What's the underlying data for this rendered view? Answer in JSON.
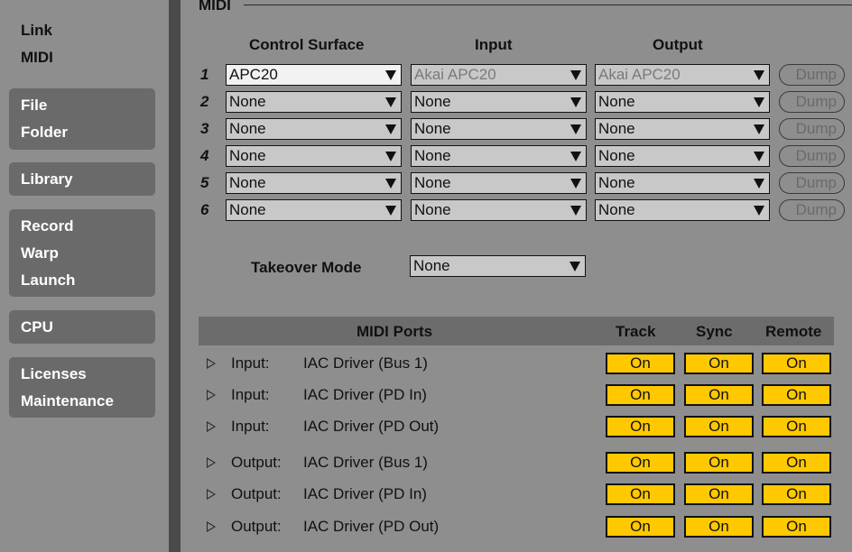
{
  "sidebar": {
    "groups": [
      {
        "items": [
          "Link",
          "MIDI"
        ]
      },
      {
        "items": [
          "File",
          "Folder"
        ]
      },
      {
        "items": [
          "Library"
        ]
      },
      {
        "items": [
          "Record",
          "Warp",
          "Launch"
        ]
      },
      {
        "items": [
          "CPU"
        ]
      },
      {
        "items": [
          "Licenses",
          "Maintenance"
        ]
      }
    ]
  },
  "section": {
    "title": "MIDI"
  },
  "columns": {
    "control_surface": "Control Surface",
    "input": "Input",
    "output": "Output"
  },
  "surfaces": [
    {
      "num": "1",
      "control_surface": "APC20",
      "input": "Akai APC20",
      "output": "Akai APC20",
      "dump": "Dump"
    },
    {
      "num": "2",
      "control_surface": "None",
      "input": "None",
      "output": "None",
      "dump": "Dump"
    },
    {
      "num": "3",
      "control_surface": "None",
      "input": "None",
      "output": "None",
      "dump": "Dump"
    },
    {
      "num": "4",
      "control_surface": "None",
      "input": "None",
      "output": "None",
      "dump": "Dump"
    },
    {
      "num": "5",
      "control_surface": "None",
      "input": "None",
      "output": "None",
      "dump": "Dump"
    },
    {
      "num": "6",
      "control_surface": "None",
      "input": "None",
      "output": "None",
      "dump": "Dump"
    }
  ],
  "takeover": {
    "label": "Takeover Mode",
    "value": "None"
  },
  "ports": {
    "headers": {
      "name": "MIDI Ports",
      "track": "Track",
      "sync": "Sync",
      "remote": "Remote"
    },
    "rows": [
      {
        "type": "Input:",
        "name": "IAC Driver (Bus 1)",
        "track": "On",
        "sync": "On",
        "remote": "On"
      },
      {
        "type": "Input:",
        "name": "IAC Driver (PD In)",
        "track": "On",
        "sync": "On",
        "remote": "On"
      },
      {
        "type": "Input:",
        "name": "IAC Driver (PD Out)",
        "track": "On",
        "sync": "On",
        "remote": "On"
      },
      {
        "type": "Output:",
        "name": "IAC Driver (Bus 1)",
        "track": "On",
        "sync": "On",
        "remote": "On"
      },
      {
        "type": "Output:",
        "name": "IAC Driver (PD In)",
        "track": "On",
        "sync": "On",
        "remote": "On"
      },
      {
        "type": "Output:",
        "name": "IAC Driver (PD Out)",
        "track": "On",
        "sync": "On",
        "remote": "On"
      }
    ]
  },
  "colors": {
    "on_button": "#ffc800",
    "panel_bg": "#8e8e8e",
    "sidebar_tab": "#6a6a6a",
    "header_bar": "#6c6c6c"
  }
}
